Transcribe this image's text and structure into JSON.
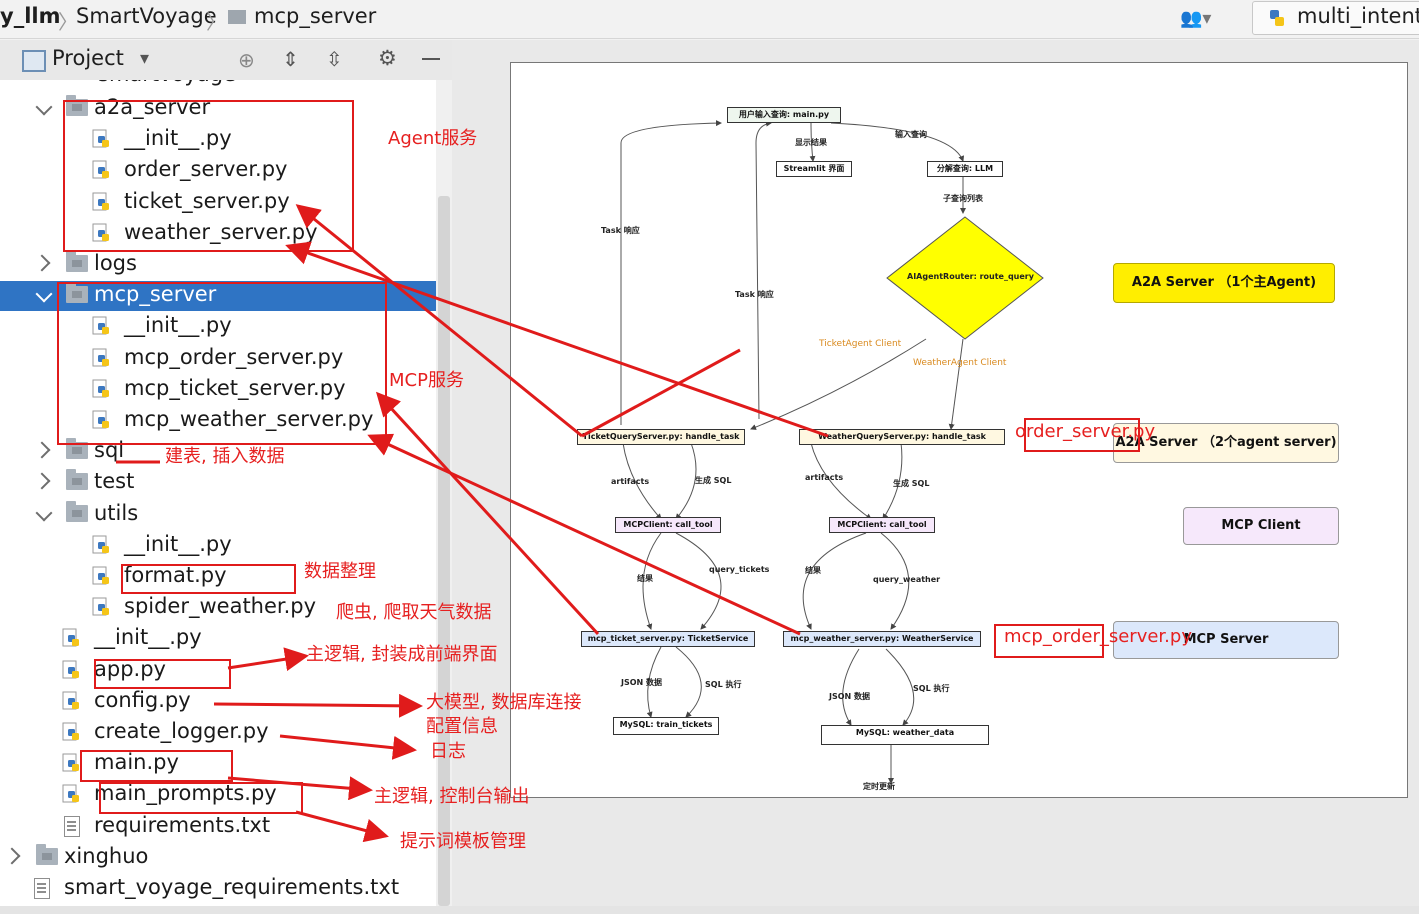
{
  "breadcrumb": {
    "project": "y_llm",
    "module": "SmartVoyage",
    "folder": "mcp_server"
  },
  "run_config": {
    "label": "multi_intents"
  },
  "project_panel": {
    "title": "Project",
    "peek_text": "smartvoyage"
  },
  "tree": [
    {
      "label": "a2a_server",
      "type": "folder",
      "expanded": true
    },
    {
      "label": "__init__.py",
      "type": "py"
    },
    {
      "label": "order_server.py",
      "type": "py"
    },
    {
      "label": "ticket_server.py",
      "type": "py"
    },
    {
      "label": "weather_server.py",
      "type": "py"
    },
    {
      "label": "logs",
      "type": "folder",
      "expanded": false
    },
    {
      "label": "mcp_server",
      "type": "folder",
      "expanded": true,
      "selected": true
    },
    {
      "label": "__init__.py",
      "type": "py"
    },
    {
      "label": "mcp_order_server.py",
      "type": "py"
    },
    {
      "label": "mcp_ticket_server.py",
      "type": "py"
    },
    {
      "label": "mcp_weather_server.py",
      "type": "py"
    },
    {
      "label": "sql",
      "type": "folder",
      "expanded": false
    },
    {
      "label": "test",
      "type": "folder",
      "expanded": false
    },
    {
      "label": "utils",
      "type": "folder",
      "expanded": true
    },
    {
      "label": "__init__.py",
      "type": "py"
    },
    {
      "label": "format.py",
      "type": "py"
    },
    {
      "label": "spider_weather.py",
      "type": "py"
    },
    {
      "label": "__init__.py",
      "type": "py"
    },
    {
      "label": "app.py",
      "type": "py"
    },
    {
      "label": "config.py",
      "type": "py"
    },
    {
      "label": "create_logger.py",
      "type": "py"
    },
    {
      "label": "main.py",
      "type": "py"
    },
    {
      "label": "main_prompts.py",
      "type": "py"
    },
    {
      "label": "requirements.txt",
      "type": "txt"
    },
    {
      "label": "xinghuo",
      "type": "folder",
      "expanded": false
    },
    {
      "label": "smart_voyage_requirements.txt",
      "type": "txt"
    }
  ],
  "diagram": {
    "nodes": {
      "user_input": "用户输入查询: main.py",
      "streamlit": "Streamlit 界面",
      "llm": "分解查询: LLM",
      "router": "AIAgentRouter: route_query",
      "ticket_query": "TicketQueryServer.py: handle_task",
      "weather_query": "WeatherQueryServer.py: handle_task",
      "mcp_client_1": "MCPClient: call_tool",
      "mcp_client_2": "MCPClient: call_tool",
      "mcp_ticket": "mcp_ticket_server.py: TicketService",
      "mcp_weather": "mcp_weather_server.py: WeatherService",
      "mysql_tickets": "MySQL: train_tickets",
      "mysql_weather": "MySQL: weather_data"
    },
    "edges": {
      "show_result": "显示结果",
      "input_query": "输入查询",
      "sub_queries": "子查询列表",
      "task_resp_1": "Task 响应",
      "task_resp_2": "Task 响应",
      "ticket_client": "TicketAgent Client",
      "weather_client": "WeatherAgent Client",
      "artifacts_1": "artifacts",
      "gen_sql_1": "生成 SQL",
      "artifacts_2": "artifacts",
      "gen_sql_2": "生成 SQL",
      "result_1": "结果",
      "query_tickets": "query_tickets",
      "result_2": "结果",
      "query_weather": "query_weather",
      "json_1": "JSON 数据",
      "sql_exec_1": "SQL 执行",
      "json_2": "JSON 数据",
      "sql_exec_2": "SQL 执行",
      "scheduled_update": "定时更新"
    },
    "legend": {
      "a2a_main": "A2A Server （1个主Agent)",
      "a2a_agents": "A2A Server （2个agent server)",
      "mcp_client": "MCP    Client",
      "mcp_server": "MCP    Server"
    },
    "legend_colors": {
      "a2a_main": "#ffee00",
      "a2a_agents": "#fff8e1",
      "mcp_client": "#f6e8fb",
      "mcp_server": "#dce8fb",
      "router": "#ffff00"
    }
  },
  "annotations": {
    "agent_service": "Agent服务",
    "mcp_service": "MCP服务",
    "sql_note": "建表, 插入数据",
    "data_format": "数据整理",
    "spider_note": "爬虫, 爬取天气数据",
    "app_note": "主逻辑, 封装成前端界面",
    "config_note_1": "大模型, 数据库连接",
    "config_note_2": "配置信息",
    "log_note": "日志",
    "main_note": "主逻辑, 控制台输出",
    "prompts_note": "提示词模板管理",
    "order_server_tag": "order_server.py",
    "mcp_order_server_tag": "mcp_order_server.py"
  },
  "colors": {
    "annotation_red": "#e01b1b",
    "selection_blue": "#2f74c4"
  }
}
